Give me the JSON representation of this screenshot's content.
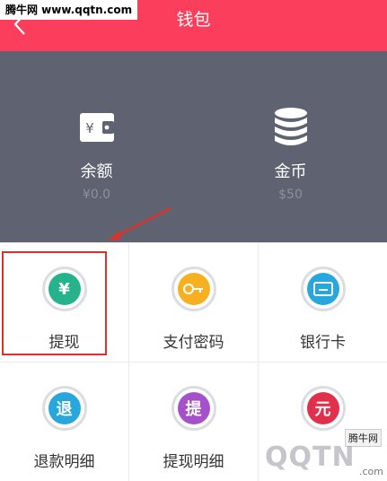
{
  "watermark_top": "腾牛网 www.qqtn.com",
  "header": {
    "title": "钱包"
  },
  "summary": {
    "balance": {
      "label": "余额",
      "value": "¥0.0"
    },
    "coins": {
      "label": "金币",
      "value": "$50"
    }
  },
  "services": [
    {
      "label": "提现",
      "icon": "yen-icon",
      "color": "#26b28a"
    },
    {
      "label": "支付密码",
      "icon": "key-icon",
      "color": "#f7b020"
    },
    {
      "label": "银行卡",
      "icon": "card-icon",
      "color": "#28a7dc"
    },
    {
      "label": "退款明细",
      "icon": "refund-icon",
      "color": "#28a7dc",
      "glyph": "退"
    },
    {
      "label": "提现明细",
      "icon": "withdraw-record-icon",
      "color": "#a651c9",
      "glyph": "提"
    },
    {
      "label": "",
      "icon": "yuan-icon",
      "color": "#e0304b",
      "glyph": "元"
    }
  ],
  "watermark_bottom": {
    "tag": "腾牛网",
    "big": "QQTN",
    "small": ".com"
  },
  "colors": {
    "header": "#fb3e5c",
    "summary_bg": "#5f6371",
    "highlight": "#d9342b"
  }
}
